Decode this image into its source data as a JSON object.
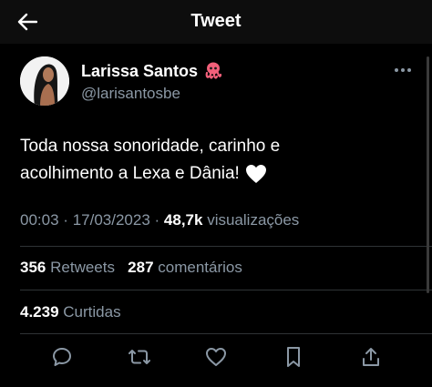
{
  "header": {
    "title": "Tweet",
    "back_icon": "arrow-left-icon"
  },
  "author": {
    "name": "Larissa Santos",
    "name_emoji": "octopus-emoji",
    "handle": "@larisantosbe"
  },
  "tweet": {
    "text_line1": "Toda nossa sonoridade, carinho e",
    "text_line2": "acolhimento a Lexa e Dânia!",
    "heart_emoji": "white-heart-emoji"
  },
  "meta": {
    "time": "00:03",
    "sep1": "·",
    "date": "17/03/2023",
    "sep2": "·",
    "views_count": "48,7k",
    "views_label": "visualizações"
  },
  "stats": {
    "retweets_count": "356",
    "retweets_label": "Retweets",
    "replies_count": "287",
    "replies_label": "comentários",
    "likes_count": "4.239",
    "likes_label": "Curtidas"
  },
  "colors": {
    "background": "#000000",
    "text_primary": "#ffffff",
    "text_secondary": "#8b98a5",
    "divider": "#2f3336"
  }
}
